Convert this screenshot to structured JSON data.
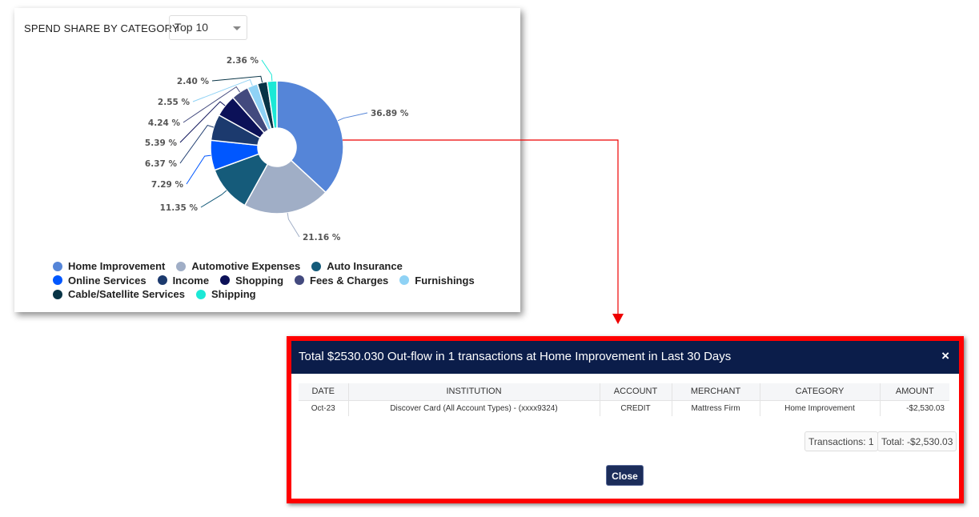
{
  "card": {
    "title": "SPEND SHARE BY CATEGORY",
    "select_value": "Top 10"
  },
  "chart_data": {
    "type": "pie",
    "donut": true,
    "categories": [
      "Home Improvement",
      "Automotive Expenses",
      "Auto Insurance",
      "Online Services",
      "Income",
      "Shopping",
      "Fees & Charges",
      "Furnishings",
      "Cable/Satellite Services",
      "Shipping"
    ],
    "values": [
      36.89,
      21.16,
      11.35,
      7.29,
      6.37,
      5.39,
      4.24,
      2.55,
      2.4,
      2.36
    ],
    "labels": [
      "36.89 %",
      "21.16 %",
      "11.35 %",
      "7.29 %",
      "6.37 %",
      "5.39 %",
      "4.24 %",
      "2.55 %",
      "2.40 %",
      "2.36 %"
    ],
    "colors": [
      "#5585d8",
      "#a0aec6",
      "#155b7a",
      "#0057ff",
      "#1c3a6e",
      "#0c1158",
      "#434a7e",
      "#8fd2f5",
      "#083446",
      "#1be8d6"
    ],
    "legend_position": "bottom"
  },
  "modal": {
    "title": "Total $2530.030 Out-flow in 1 transactions at Home Improvement in Last 30 Days",
    "close_x": "×",
    "columns": [
      "DATE",
      "INSTITUTION",
      "ACCOUNT",
      "MERCHANT",
      "CATEGORY",
      "AMOUNT"
    ],
    "rows": [
      [
        "Oct-23",
        "Discover Card (All Account Types) - (xxxx9324)",
        "CREDIT",
        "Mattress Firm",
        "Home Improvement",
        "-$2,530.03"
      ]
    ],
    "transactions": "Transactions: 1",
    "total": "Total: -$2,530.03",
    "close_label": "Close"
  }
}
